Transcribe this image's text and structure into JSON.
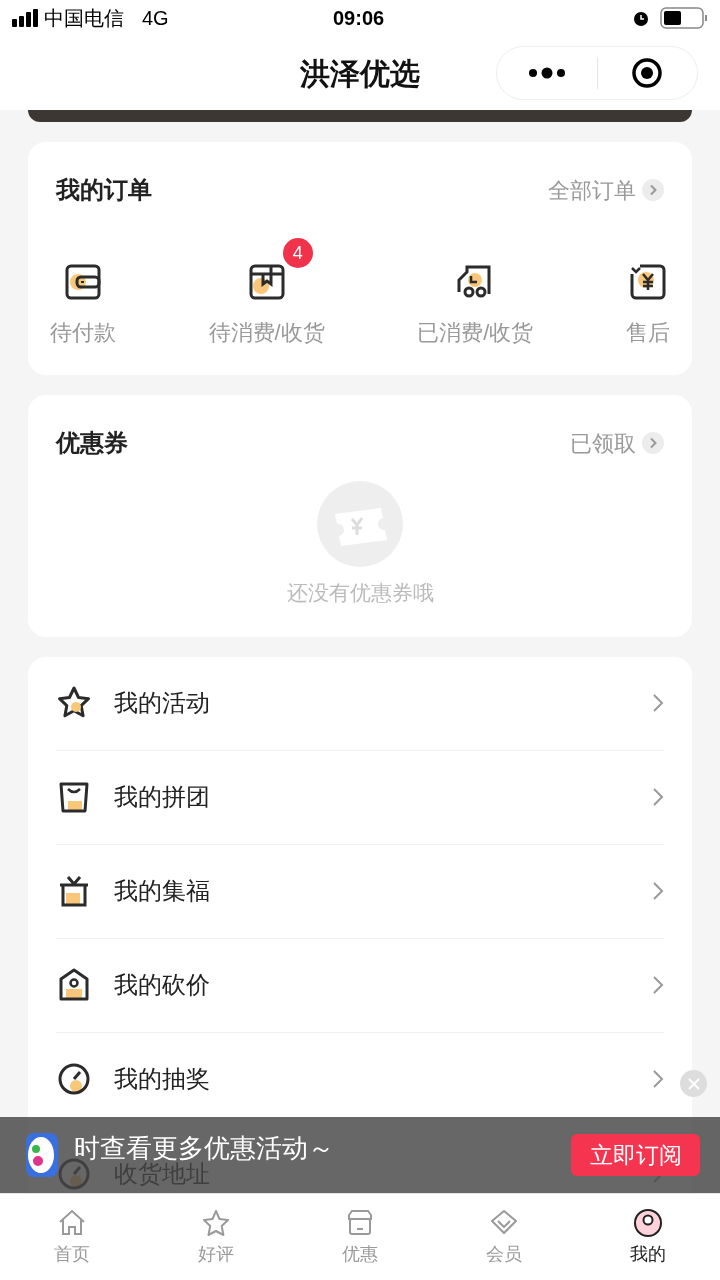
{
  "status_bar": {
    "carrier": "中国电信",
    "network": "4G",
    "time": "09:06"
  },
  "nav_bar": {
    "title": "洪泽优选"
  },
  "orders": {
    "title": "我的订单",
    "link": "全部订单",
    "items": [
      {
        "label": "待付款"
      },
      {
        "label": "待消费/收货",
        "badge": "4"
      },
      {
        "label": "已消费/收货"
      },
      {
        "label": "售后"
      }
    ]
  },
  "coupons": {
    "title": "优惠券",
    "link": "已领取",
    "empty_text": "还没有优惠券哦"
  },
  "menu": [
    {
      "label": "我的活动"
    },
    {
      "label": "我的拼团"
    },
    {
      "label": "我的集福"
    },
    {
      "label": "我的砍价"
    },
    {
      "label": "我的抽奖"
    },
    {
      "label": "收货地址"
    }
  ],
  "subscribe_banner": {
    "text": "时查看更多优惠活动～",
    "button": "立即订阅"
  },
  "tab_bar": [
    {
      "label": "首页",
      "selected": false
    },
    {
      "label": "好评",
      "selected": false
    },
    {
      "label": "优惠",
      "selected": false
    },
    {
      "label": "会员",
      "selected": false
    },
    {
      "label": "我的",
      "selected": true
    }
  ]
}
